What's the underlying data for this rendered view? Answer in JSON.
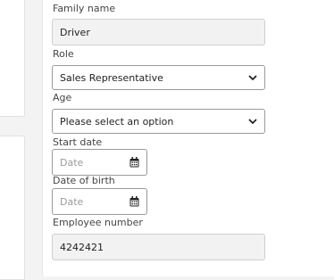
{
  "form": {
    "family_name": {
      "label": "Family name",
      "value": "Driver"
    },
    "role": {
      "label": "Role",
      "value": "Sales Representative"
    },
    "age": {
      "label": "Age",
      "value": "Please select an option"
    },
    "start_date": {
      "label": "Start date",
      "placeholder": "Date"
    },
    "date_of_birth": {
      "label": "Date of birth",
      "placeholder": "Date"
    },
    "employee_number": {
      "label": "Employee number",
      "value": "4242421"
    }
  }
}
